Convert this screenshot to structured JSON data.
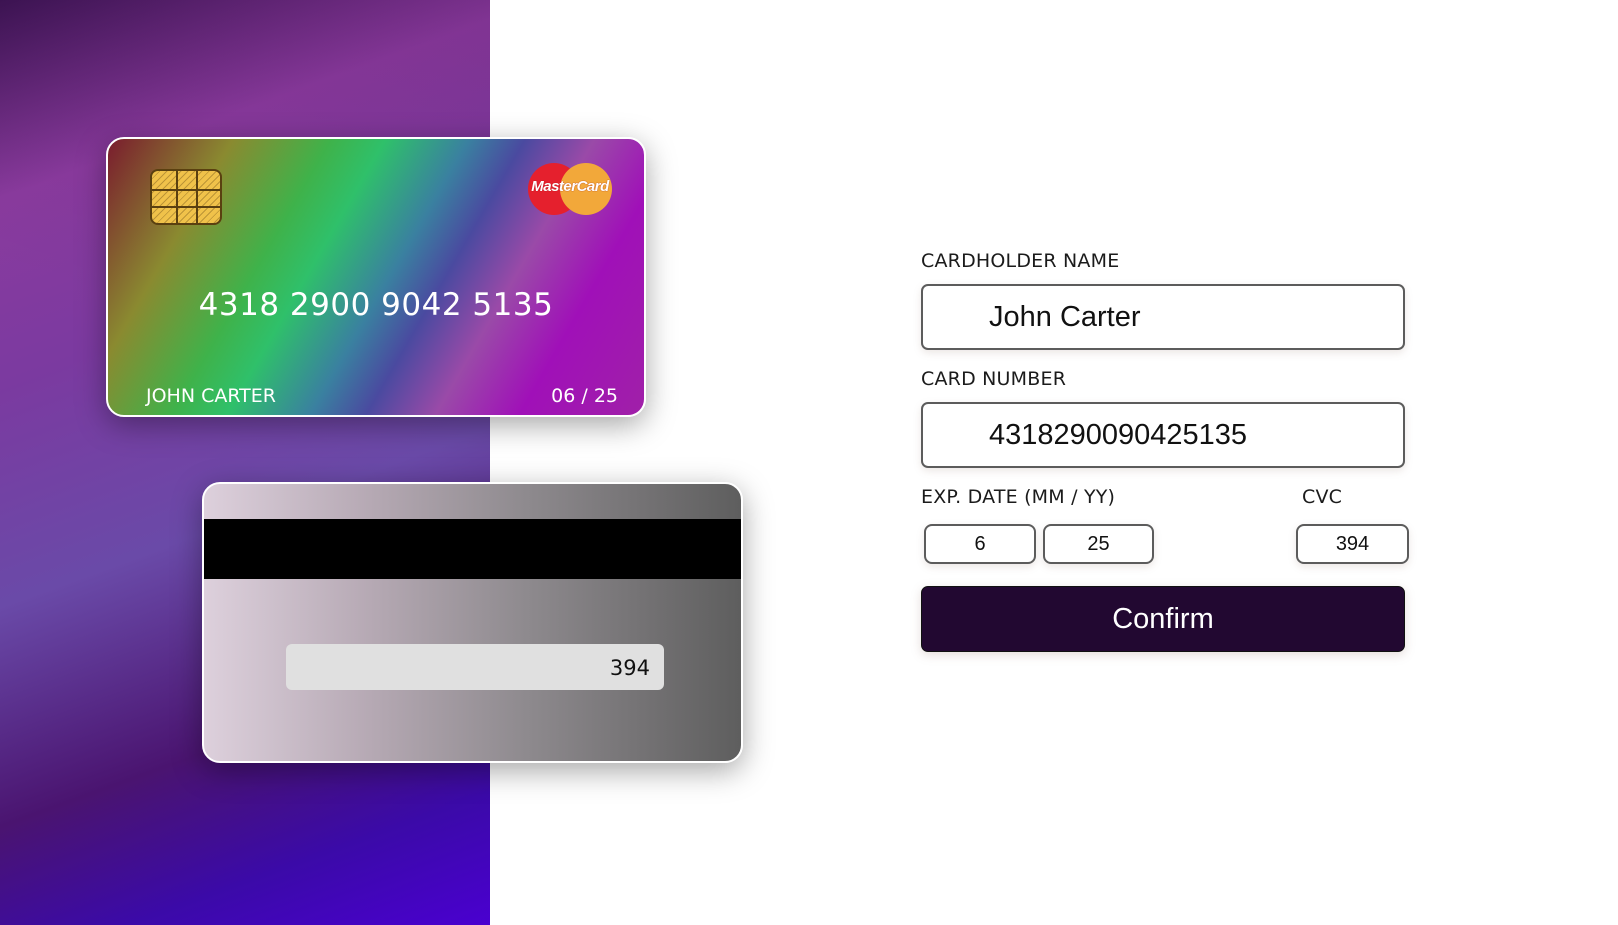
{
  "card_front": {
    "brand": "MasterCard",
    "number": "4318 2900 9042 5135",
    "holder": "JOHN CARTER",
    "expiry": "06 / 25"
  },
  "card_back": {
    "cvc": "394"
  },
  "form": {
    "cardholder_label": "CARDHOLDER NAME",
    "cardholder_value": "John Carter",
    "card_number_label": "CARD NUMBER",
    "card_number_value": "4318290090425135",
    "exp_label": "EXP. DATE (MM / YY)",
    "exp_month_value": "6",
    "exp_year_value": "25",
    "cvc_label": "CVC",
    "cvc_value": "394",
    "confirm_label": "Confirm"
  },
  "colors": {
    "confirm_bg": "#220831",
    "left_panel_top": "#8a3b9e",
    "left_panel_bottom": "#4a00d0"
  },
  "icons": {
    "chip": "chip-icon",
    "brand_logo": "mastercard-logo"
  }
}
